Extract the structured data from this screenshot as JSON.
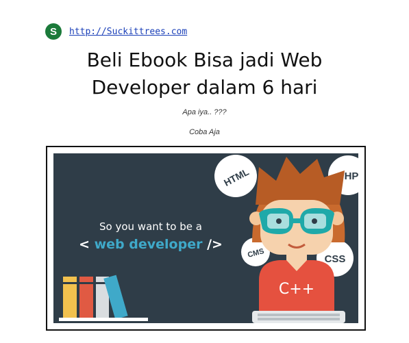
{
  "header": {
    "logo_letter": "S",
    "site_url": "http://Suckittrees.com"
  },
  "main": {
    "title_line1": "Beli Ebook Bisa jadi Web",
    "title_line2": "Developer dalam 6 hari",
    "subtitle1": "Apa iya.. ???",
    "subtitle2": "Coba Aja"
  },
  "banner": {
    "tagline": "So you want to be a",
    "headline_open": "<",
    "headline_text": "web developer",
    "headline_close": "/>",
    "bubble_html": "HTML",
    "bubble_php": "PHP",
    "bubble_cms": "CMS",
    "bubble_css": "CSS",
    "shirt_text": "C++",
    "colors": {
      "background": "#2f3d48",
      "accent_blue": "#3fa9c9",
      "shirt": "#e5513f"
    }
  }
}
